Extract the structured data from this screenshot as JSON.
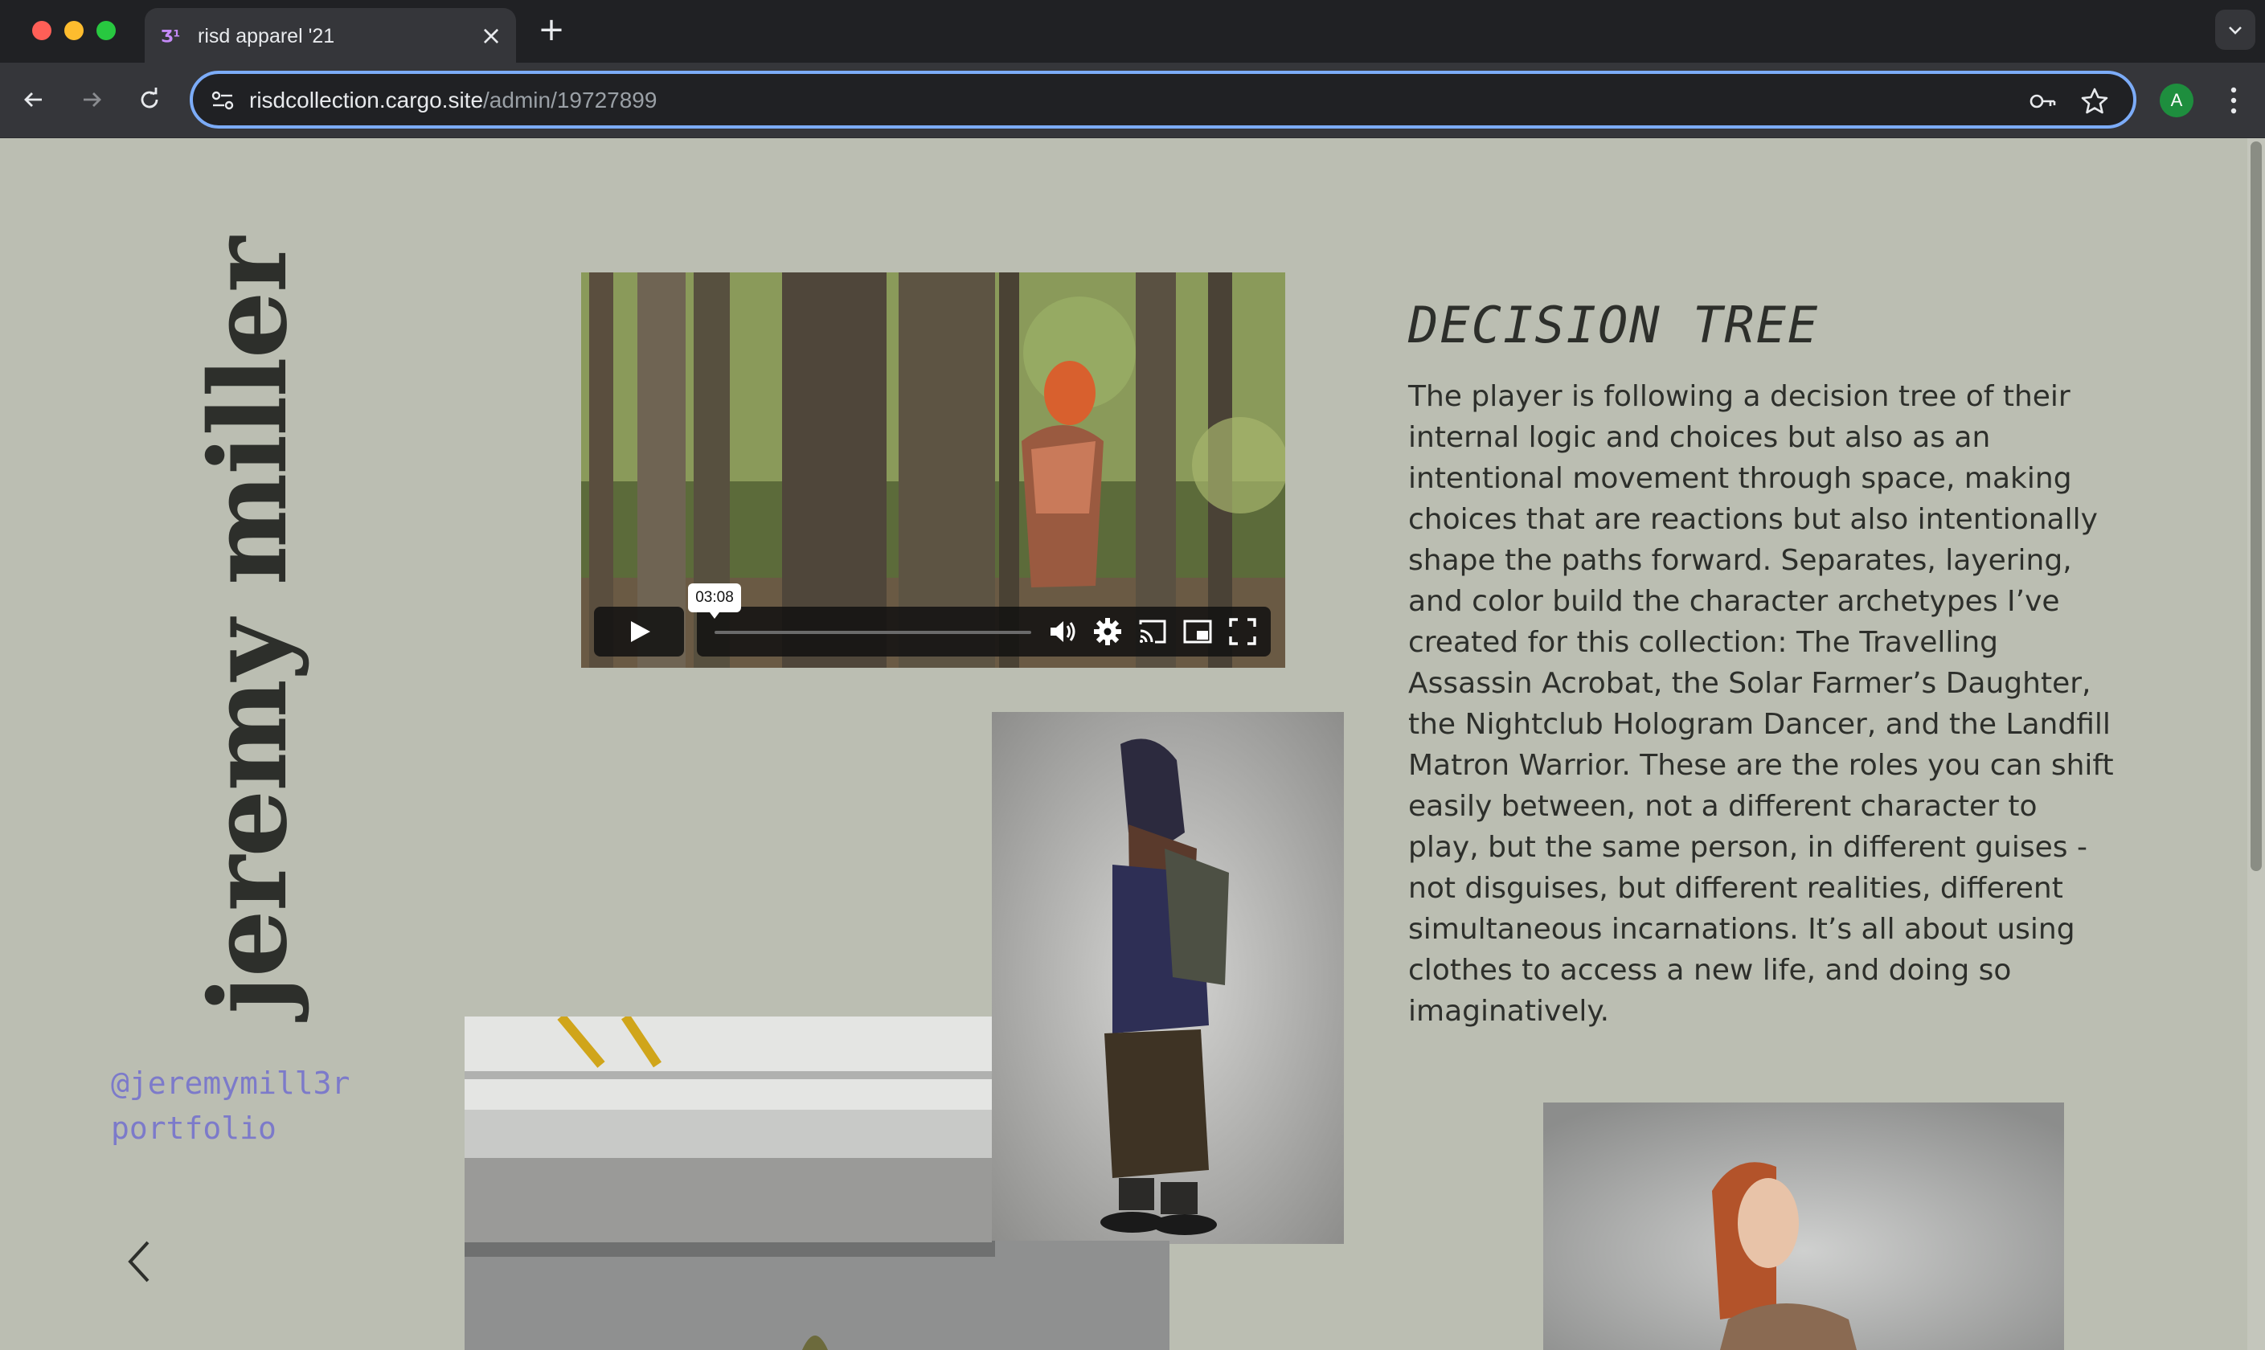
{
  "browser": {
    "tab": {
      "title": "risd apparel '21",
      "favicon": "Ʒ¹"
    },
    "new_tab_symbol": "+",
    "close_symbol": "×",
    "address": {
      "domain": "risdcollection.cargo.site",
      "path": "/admin/19727899"
    },
    "profile_initial": "A"
  },
  "page": {
    "artist_name": "jeremy miller",
    "instagram_link": "@jeremymill3r",
    "portfolio_link": "portfolio",
    "title": "DECISION TREE",
    "description": "The player is following a decision tree of their internal logic and choices but also as an intentional movement through space, making choices that are reactions but also intentionally shape the paths forward. Separates, layering, and color build the character archetypes I’ve created for this collection: The Travelling Assassin Acrobat, the Solar Farmer’s Daughter, the Nightclub Hologram Dancer, and the Landfill Matron Warrior. These are the roles you can shift easily between, not a different character to play, but the same person, in different guises - not disguises, but different realities, different simultaneous incarnations. It’s all about using clothes to access a new life, and doing so imaginatively.",
    "video": {
      "time_tooltip": "03:08"
    }
  },
  "colors": {
    "page_bg": "#bbbeb2",
    "text": "#2d2f2b",
    "link": "#7c7aca",
    "omnibox_focus": "#7cacf8"
  }
}
